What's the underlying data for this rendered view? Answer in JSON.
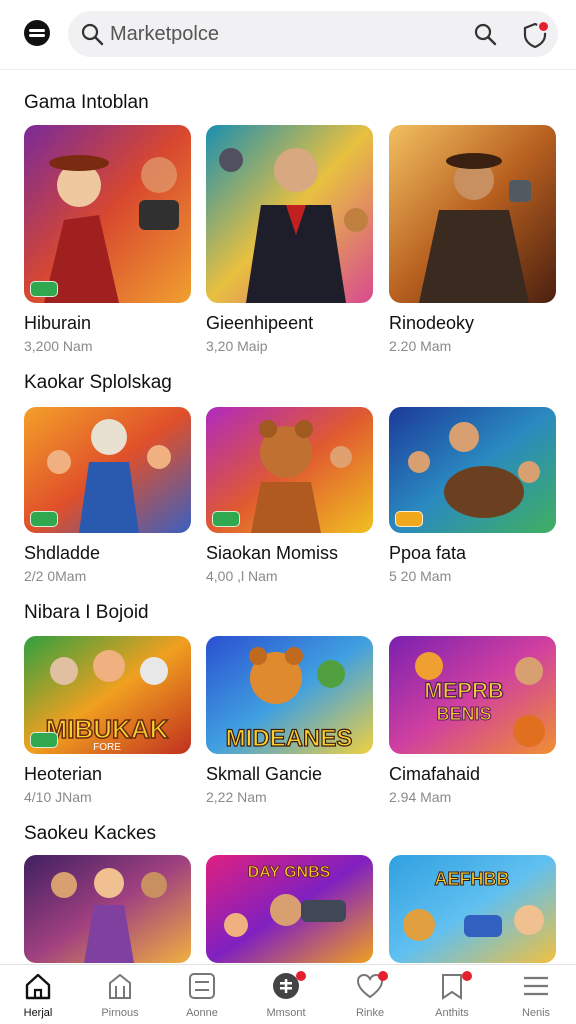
{
  "header": {
    "search_placeholder": "Marketpolce",
    "menu_icon": "menu-icon",
    "search_icon": "search-icon",
    "notification_icon": "shield-notification-icon"
  },
  "sections": [
    {
      "title": "Gama Intoblan",
      "cards": [
        {
          "name": "Hiburain",
          "meta": "3,200 Nam",
          "theme": "purple-red"
        },
        {
          "name": "Gieenhipeent",
          "meta": "3,20 Maip",
          "theme": "teal-dark"
        },
        {
          "name": "Rinodeoky",
          "meta": "2.20 Mam",
          "theme": "amber-brown"
        }
      ]
    },
    {
      "title": "Kaokar Splolskag",
      "cards": [
        {
          "name": "Shdladde",
          "meta": "2/2 0Mam",
          "theme": "orange-blue"
        },
        {
          "name": "Siaokan Momiss",
          "meta": "4,00 ,l Nam",
          "theme": "purple-orange"
        },
        {
          "name": "Ppoa fata",
          "meta": "5 20 Mam",
          "theme": "blue-green"
        }
      ]
    },
    {
      "title": "Nibara I Bojoid",
      "cards": [
        {
          "name": "Heoterian",
          "meta": "4/10 JNam",
          "theme": "green-orange",
          "art_text": "MIBUKAK",
          "art_sub": "FORE"
        },
        {
          "name": "Skmall Gancie",
          "meta": "2,22 Nam",
          "theme": "blue-yellow",
          "art_text": "MIDEANES",
          "art_sub": ""
        },
        {
          "name": "Cimafahaid",
          "meta": "2.94 Mam",
          "theme": "purple-pink",
          "art_text": "MEPRB",
          "art_sub": "BENIS"
        }
      ]
    },
    {
      "title": "Saokeu Kackes",
      "cards": [
        {
          "name": "",
          "meta": "",
          "theme": "dark-purple"
        },
        {
          "name": "",
          "meta": "",
          "theme": "pink-purple",
          "art_text": "DAY GNBS",
          "art_sub": ""
        },
        {
          "name": "",
          "meta": "",
          "theme": "sky-blue",
          "art_text": "AEFHBB",
          "art_sub": ""
        }
      ]
    }
  ],
  "bottom_nav": [
    {
      "label": "Herjal",
      "icon": "home-icon",
      "active": true
    },
    {
      "label": "Pirnous",
      "icon": "store-icon",
      "active": false
    },
    {
      "label": "Aonne",
      "icon": "grid-icon",
      "active": false
    },
    {
      "label": "Mmsont",
      "icon": "chat-icon",
      "active": false
    },
    {
      "label": "Rinke",
      "icon": "heart-icon",
      "active": false
    },
    {
      "label": "Anthits",
      "icon": "bookmark-icon",
      "active": false
    },
    {
      "label": "Nenis",
      "icon": "hamburger-icon",
      "active": false
    }
  ],
  "colors": {
    "accent_red": "#e5202e",
    "badge_green": "#2fa84f",
    "badge_yellow": "#f2a81d"
  }
}
